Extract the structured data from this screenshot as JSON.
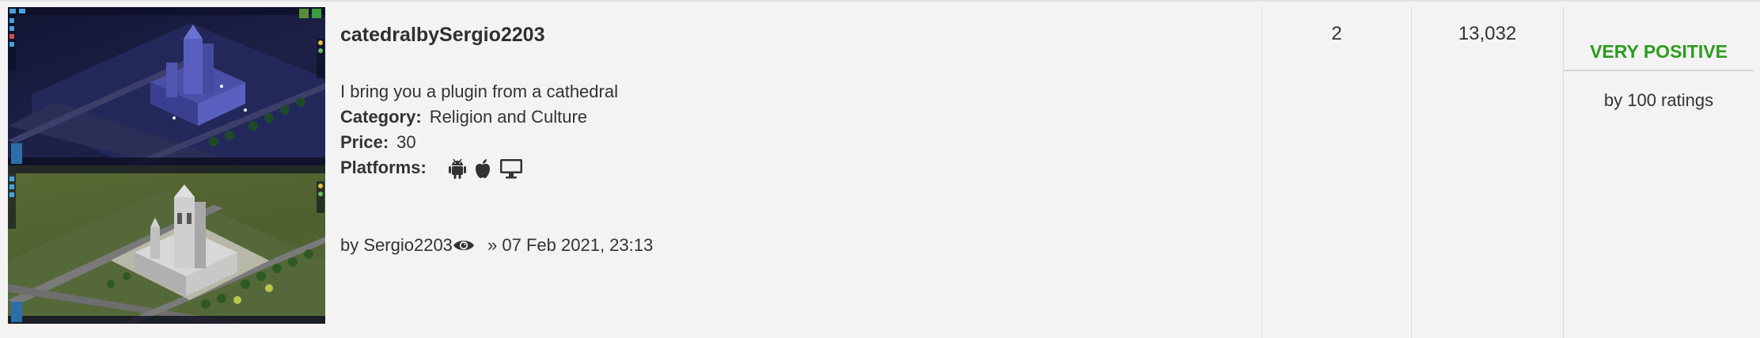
{
  "listing": {
    "title": "catedralbySergio2203",
    "description": "I bring you a plugin from a cathedral",
    "category_label": "Category:",
    "category_value": "Religion and Culture",
    "price_label": "Price:",
    "price_value": "30",
    "platforms_label": "Platforms:",
    "platform_icons": [
      "android-icon",
      "apple-icon",
      "desktop-icon"
    ],
    "by_prefix": "by",
    "author": "Sergio2203",
    "date_text": "» 07 Feb 2021, 23:13"
  },
  "stats": {
    "replies": "2",
    "views": "13,032"
  },
  "rating": {
    "label": "VERY POSITIVE",
    "count_text": "by 100 ratings",
    "color": "#2e9a1e"
  },
  "thumbnail": {
    "icon": "cathedral-screenshot-thumbnail"
  }
}
